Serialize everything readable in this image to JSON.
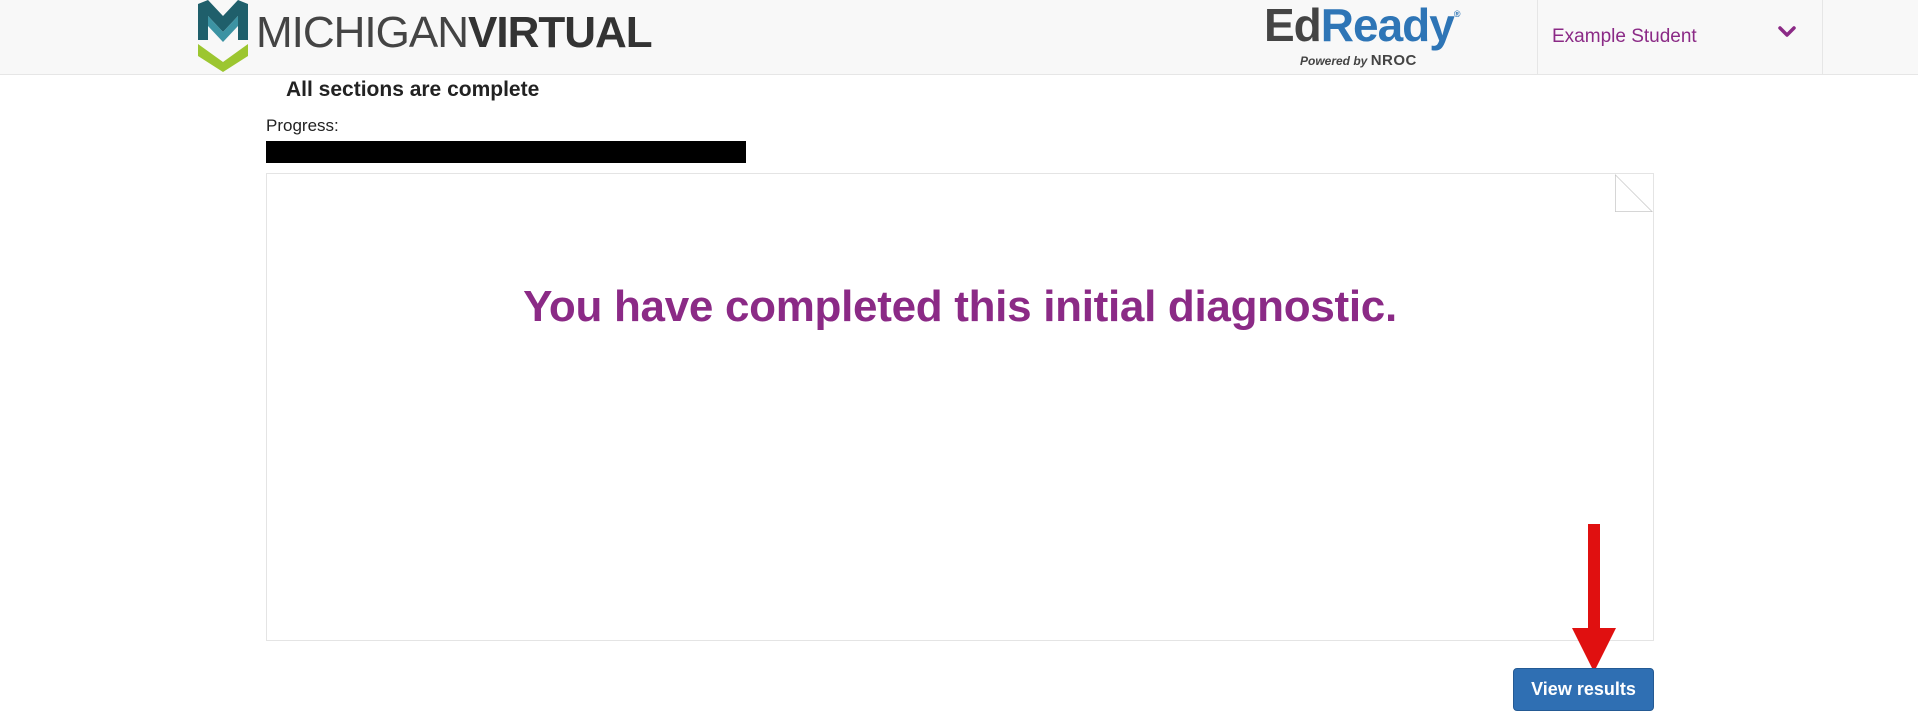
{
  "header": {
    "logo_light": "MICHIGAN",
    "logo_bold": "VIRTUAL",
    "edready_ed": "Ed",
    "edready_ready": "Ready",
    "edready_reg": "®",
    "powered_by": "Powered by",
    "nroc": "NROC",
    "user_name": "Example Student",
    "colors": {
      "topbar_bg": "#f8f8f8",
      "mv_dark_teal": "#1f5f6b",
      "mv_light_teal": "#3c93a3",
      "mv_green": "#9cc630",
      "edready_blue": "#2e75b6",
      "accent_purple": "#8b2a86"
    }
  },
  "status": {
    "section_title": "All sections are complete",
    "progress_label": "Progress:",
    "progress_fraction": 1.0
  },
  "panel": {
    "message": "You have completed this initial diagnostic."
  },
  "actions": {
    "view_results_label": "View results",
    "button_color": "#2f6fb3",
    "annotation_arrow_color": "#e01010"
  },
  "icons": {
    "user_menu": "chevron-down-icon",
    "page_corner": "folded-corner-icon",
    "annotation": "red-arrow-down-icon"
  }
}
